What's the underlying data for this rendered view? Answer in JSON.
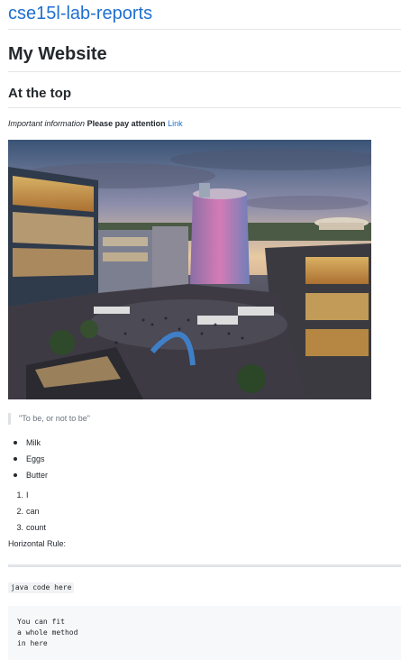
{
  "header": {
    "site_title": "cse15l-lab-reports"
  },
  "content": {
    "h1": "My Website",
    "h2": "At the top",
    "info": {
      "italic": "Important information",
      "bold": "Please pay attention",
      "link": "Link"
    },
    "quote": "\"To be, or not to be\"",
    "bullets": [
      "Milk",
      "Eggs",
      "Butter"
    ],
    "numbered": [
      {
        "num": "1.",
        "text": "I"
      },
      {
        "num": "2.",
        "text": "can"
      },
      {
        "num": "3.",
        "text": "count"
      }
    ],
    "hr_label": "Horizontal Rule:",
    "inline_code": "java code here",
    "code_block": "You can fit\na whole method\nin here"
  },
  "colors": {
    "link": "#1f6fd1",
    "text": "#24292e",
    "muted": "#6a737d"
  }
}
